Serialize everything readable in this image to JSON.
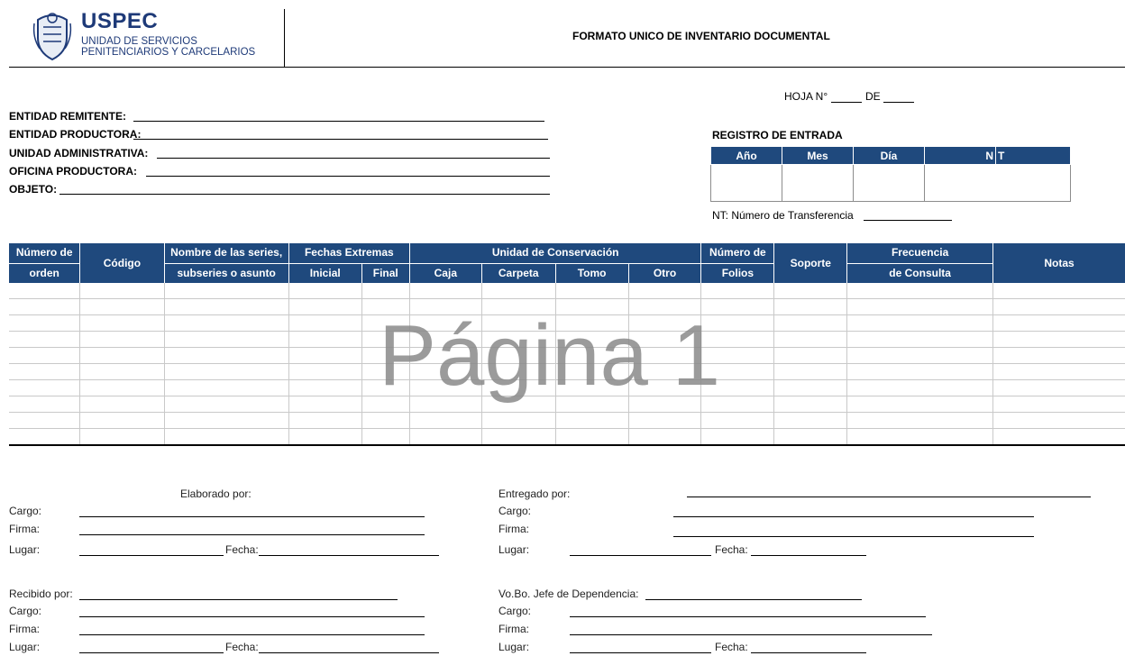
{
  "header": {
    "logo_brand": "USPEC",
    "logo_line1": "UNIDAD DE SERVICIOS",
    "logo_line2": "PENITENCIARIOS Y CARCELARIOS",
    "title": "FORMATO UNICO DE INVENTARIO DOCUMENTAL"
  },
  "hoja": {
    "label": "HOJA N°",
    "de": "DE"
  },
  "fields": {
    "entidad_remitente": "ENTIDAD REMITENTE:",
    "entidad_productora": "ENTIDAD PRODUCTORA:",
    "unidad_administrativa": "UNIDAD ADMINISTRATIVA:",
    "oficina_productora": "OFICINA PRODUCTORA:",
    "objeto": "OBJETO:"
  },
  "registro": {
    "title": "REGISTRO DE ENTRADA",
    "cols": [
      "Año",
      "Mes",
      "Día",
      "N",
      "T"
    ],
    "nt_note": "NT: Número de Transferencia"
  },
  "table": {
    "h_numero1": "Número de",
    "h_numero2": "orden",
    "h_codigo": "Código",
    "h_nombre1": "Nombre de las series,",
    "h_nombre2": "subseries o asunto",
    "h_fechas": "Fechas Extremas",
    "h_inicial": "Inicial",
    "h_final": "Final",
    "h_unidad": "Unidad de Conservación",
    "h_caja": "Caja",
    "h_carpeta": "Carpeta",
    "h_tomo": "Tomo",
    "h_otro": "Otro",
    "h_folios1": "Número de",
    "h_folios2": "Folios",
    "h_soporte": "Soporte",
    "h_frecuencia1": "Frecuencia",
    "h_frecuencia2": "de Consulta",
    "h_notas": "Notas",
    "rows": 10
  },
  "watermark": "Página 1",
  "footer": {
    "elaborado": "Elaborado por:",
    "entregado": "Entregado por:",
    "recibido": "Recibido por:",
    "vobo": "Vo.Bo. Jefe de Dependencia:",
    "cargo": "Cargo:",
    "firma": "Firma:",
    "lugar": "Lugar:",
    "fecha": "Fecha:"
  }
}
